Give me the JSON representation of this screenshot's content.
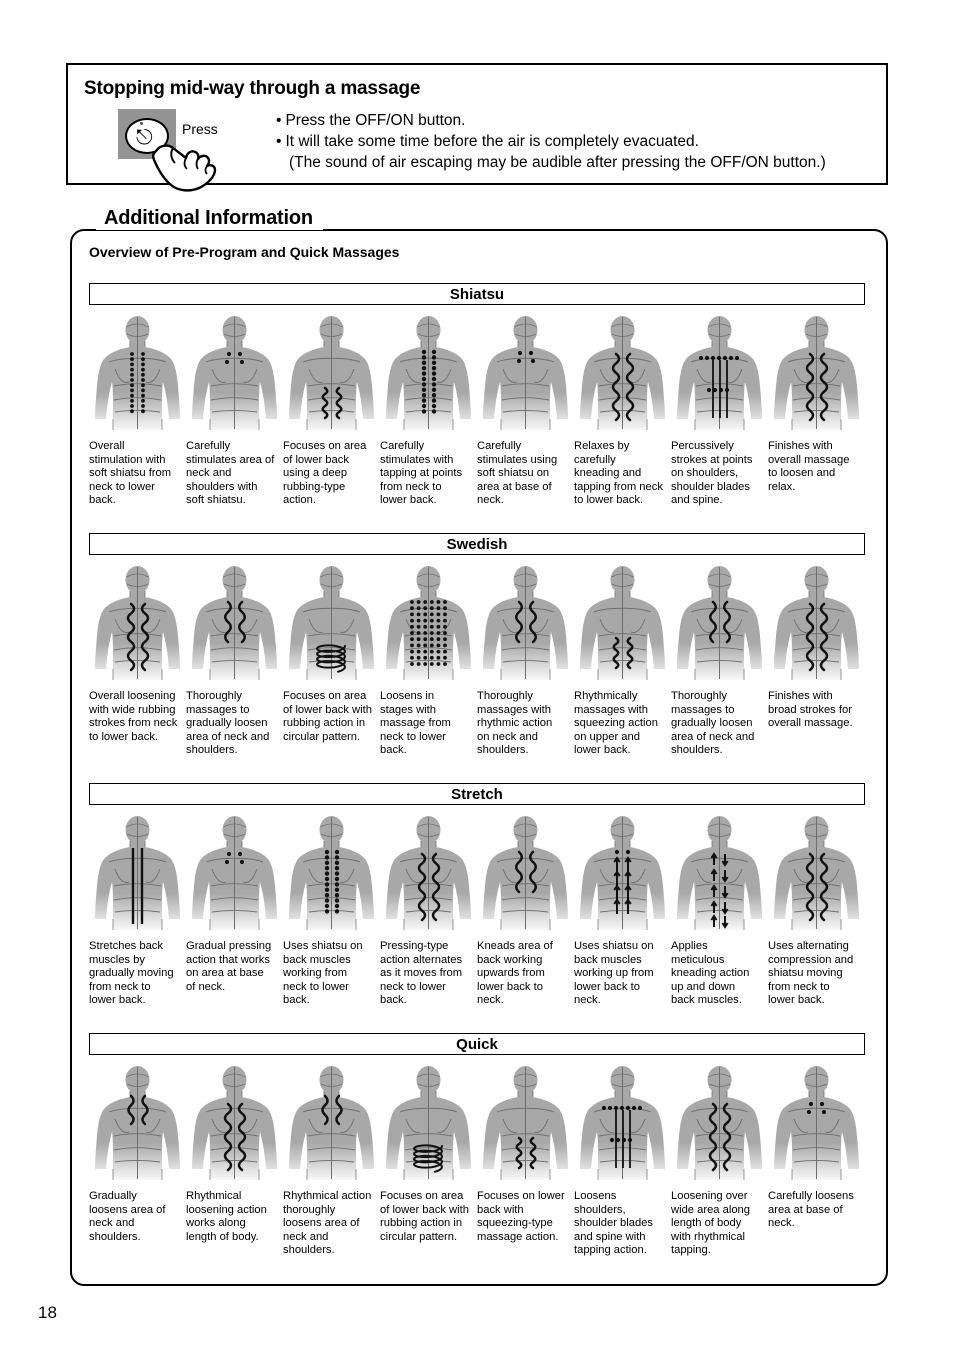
{
  "note": {
    "title": "Stopping mid-way through a massage",
    "press_label": "Press",
    "power_icon": "power-icon",
    "lines": [
      {
        "bullet": "•",
        "text": "Press the OFF/ON button.",
        "indent": false
      },
      {
        "bullet": "•",
        "text": "It will take some time before the air is completely evacuated.",
        "indent": false
      },
      {
        "bullet": "",
        "text": "(The sound of air escaping may be audible after pressing the OFF/ON button.)",
        "indent": true
      }
    ]
  },
  "additional_information": {
    "legend": "Additional Information",
    "subtitle": "Overview of Pre-Program and Quick Massages"
  },
  "programs": [
    {
      "title": "Shiatsu",
      "items": [
        {
          "figure": "shiatsu-dual-dot-column",
          "caption": "Overall stimulation with soft shiatsu from neck to lower back."
        },
        {
          "figure": "neck-shoulder-four-dots",
          "caption": "Carefully stimulates area of neck and shoulders with soft shiatsu."
        },
        {
          "figure": "lower-back-wave-pair",
          "caption": "Focuses on area of lower back using a deep rubbing-type action."
        },
        {
          "figure": "spine-dot-column-tapping",
          "caption": "Carefully stimulates with tapping at points from neck to lower back."
        },
        {
          "figure": "base-of-neck-four-dots",
          "caption": "Carefully stimulates using soft shiatsu on area at base of neck."
        },
        {
          "figure": "full-back-wave-pair",
          "caption": "Relaxes by carefully kneading and tapping from neck to lower back."
        },
        {
          "figure": "shoulder-dots-straight-lines",
          "caption": "Percussively strokes at points on shoulders, shoulder blades and spine."
        },
        {
          "figure": "full-back-wave-pair",
          "caption": "Finishes with overall massage to loosen and relax."
        }
      ]
    },
    {
      "title": "Swedish",
      "items": [
        {
          "figure": "full-back-wave-pair",
          "caption": "Overall loosening with wide rubbing strokes from neck to lower back."
        },
        {
          "figure": "upper-back-wave-short",
          "caption": "Thoroughly massages to gradually loosen area of neck and shoulders."
        },
        {
          "figure": "lower-back-spiral",
          "caption": "Focuses on area of lower back with rubbing action in circular pattern."
        },
        {
          "figure": "dense-dot-grid",
          "caption": "Loosens in stages with massage from neck to lower back."
        },
        {
          "figure": "upper-back-wave-short",
          "caption": "Thoroughly massages with rhythmic action on neck and shoulders."
        },
        {
          "figure": "lower-back-wave-pair",
          "caption": "Rhythmically massages with squeezing action on upper and lower back."
        },
        {
          "figure": "upper-back-wave-short",
          "caption": "Thoroughly massages to gradually loosen area of neck and shoulders."
        },
        {
          "figure": "full-back-wave-pair",
          "caption": "Finishes with broad strokes for overall massage."
        }
      ]
    },
    {
      "title": "Stretch",
      "items": [
        {
          "figure": "spine-straight-bars",
          "caption": "Stretches back muscles by gradually moving from neck to lower back."
        },
        {
          "figure": "neck-shoulder-four-dots",
          "caption": "Gradual pressing action that works on area at base of neck."
        },
        {
          "figure": "spine-dot-column-tapping",
          "caption": "Uses shiatsu on back muscles working from neck to lower back."
        },
        {
          "figure": "full-back-wave-pair",
          "caption": "Pressing-type action alternates as it moves from neck to lower back."
        },
        {
          "figure": "upper-back-wave-short",
          "caption": "Kneads area of back working upwards from lower back to neck."
        },
        {
          "figure": "upward-arrows-pair",
          "caption": "Uses shiatsu on back muscles working up from lower back to neck."
        },
        {
          "figure": "double-arrows-dots",
          "caption": "Applies meticulous kneading action up and down back muscles."
        },
        {
          "figure": "full-back-wave-pair",
          "caption": "Uses alternating compression and shiatsu moving from neck to lower back."
        }
      ]
    },
    {
      "title": "Quick",
      "items": [
        {
          "figure": "neck-wave-short",
          "caption": "Gradually loosens area of neck and shoulders."
        },
        {
          "figure": "full-back-wave-pair",
          "caption": "Rhythmical loosening action works along length of body."
        },
        {
          "figure": "neck-wave-short",
          "caption": "Rhythmical action thoroughly loosens area of neck and shoulders."
        },
        {
          "figure": "lower-back-spiral",
          "caption": "Focuses on area of lower back with rubbing action in circular pattern."
        },
        {
          "figure": "lower-back-wave-pair",
          "caption": "Focuses on lower back with squeezing-type massage action."
        },
        {
          "figure": "shoulder-dots-straight-lines",
          "caption": "Loosens shoulders, shoulder blades and spine with tapping action."
        },
        {
          "figure": "full-back-wave-pair",
          "caption": "Loosening over wide area along length of body with rhythmical tapping."
        },
        {
          "figure": "neck-shoulder-four-dots",
          "caption": "Carefully loosens area at base of neck."
        }
      ]
    }
  ],
  "page_number": "18",
  "colors": {
    "body_fill": "#a8a8a8",
    "body_line": "#6e6e6e",
    "mark": "#111111",
    "panel_border": "#000000",
    "swatch": "#949494"
  }
}
